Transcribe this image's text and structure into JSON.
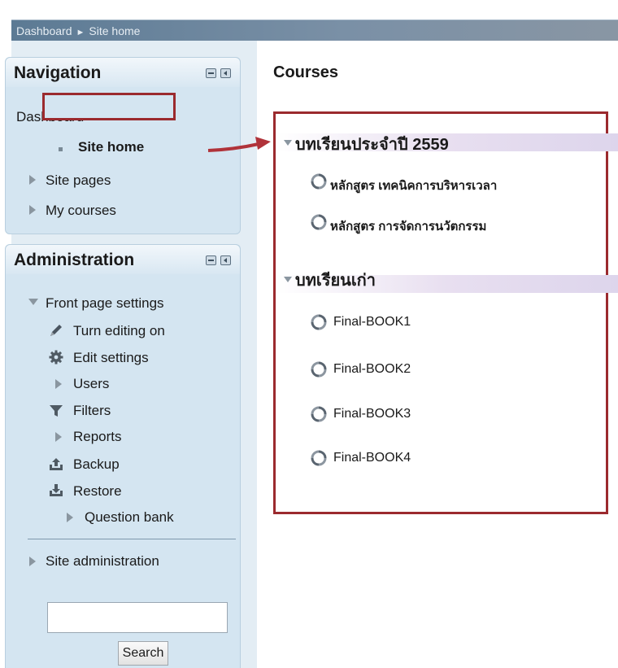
{
  "breadcrumb": {
    "items": [
      "Dashboard",
      "Site home"
    ],
    "separator": "►"
  },
  "navigation": {
    "title": "Navigation",
    "items": [
      {
        "label": "Dashboard"
      },
      {
        "label": "Site home",
        "icon": "bullet-icon"
      },
      {
        "label": "Site pages",
        "icon": "expand-arrow-icon"
      },
      {
        "label": "My courses",
        "icon": "expand-arrow-icon"
      }
    ]
  },
  "administration": {
    "title": "Administration",
    "front_page_settings": "Front page settings",
    "items": [
      {
        "label": "Turn editing on",
        "icon": "pencil-icon"
      },
      {
        "label": "Edit settings",
        "icon": "gear-icon"
      },
      {
        "label": "Users",
        "icon": "expand-arrow-icon"
      },
      {
        "label": "Filters",
        "icon": "filter-icon"
      },
      {
        "label": "Reports",
        "icon": "expand-arrow-icon"
      },
      {
        "label": "Backup",
        "icon": "backup-icon"
      },
      {
        "label": "Restore",
        "icon": "restore-icon"
      },
      {
        "label": "Question bank",
        "icon": "expand-arrow-icon"
      }
    ],
    "site_administration": "Site administration"
  },
  "search": {
    "value": "",
    "button_label": "Search"
  },
  "courses": {
    "heading": "Courses",
    "categories": [
      {
        "title": "บทเรียนประจำปี 2559",
        "courses": [
          "หลักสูตร เทคนิคการบริหารเวลา",
          "หลักสูตร การจัดการนวัตกรรม"
        ]
      },
      {
        "title": "บทเรียนเก่า",
        "courses": [
          "Final-BOOK1",
          "Final-BOOK2",
          "Final-BOOK3",
          "Final-BOOK4"
        ]
      }
    ]
  },
  "colors": {
    "highlight_border": "#9b2a2e",
    "block_background": "#d4e5f1",
    "breadcrumb_bar": "#6d859c"
  }
}
